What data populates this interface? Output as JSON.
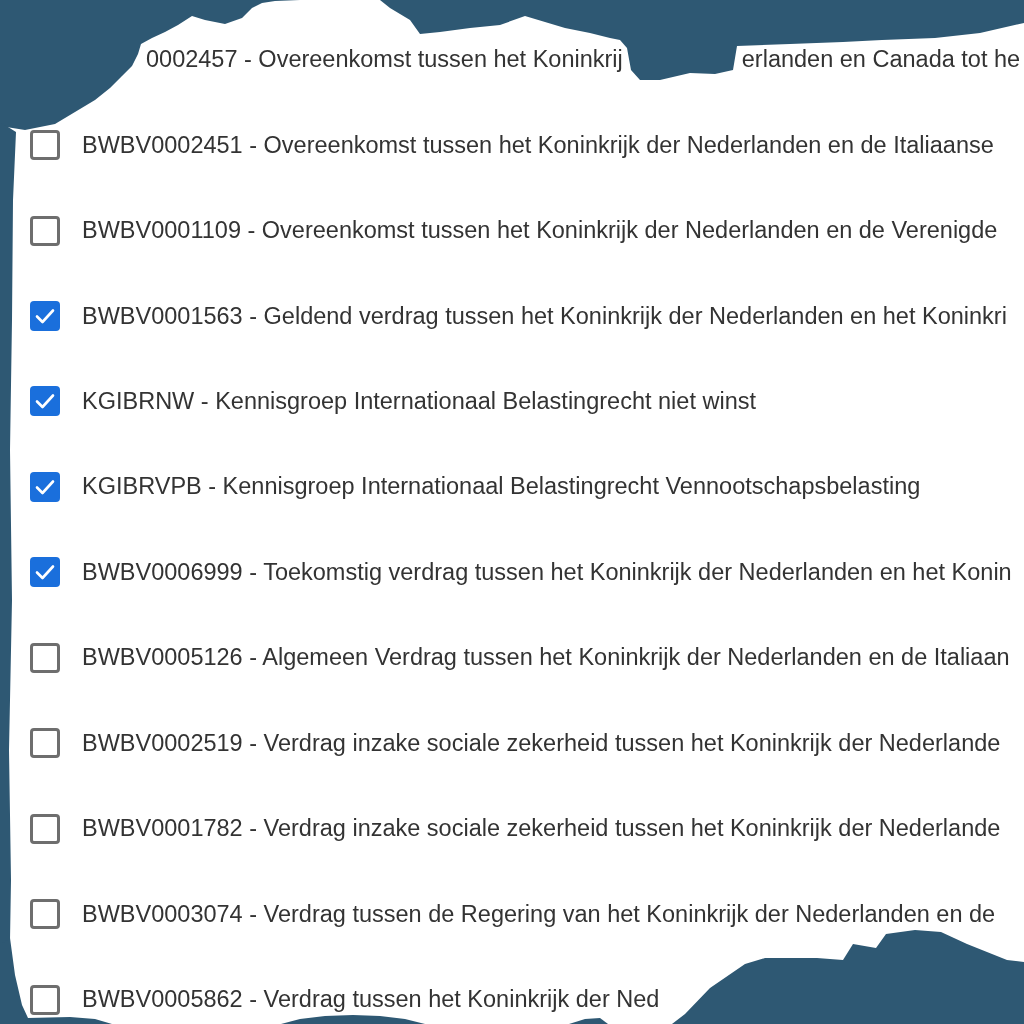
{
  "list": {
    "partial_row": {
      "fragments": [
        "0002457 - Overeenkomst tussen het Koninkrij",
        "erlanden en Canada tot he"
      ]
    },
    "rows": [
      {
        "label": "BWBV0002451 - Overeenkomst tussen het Koninkrijk der Nederlanden en de Italiaanse",
        "checked": false
      },
      {
        "label": "BWBV0001109 - Overeenkomst tussen het Koninkrijk der Nederlanden en de Verenigde",
        "checked": false
      },
      {
        "label": "BWBV0001563 - Geldend verdrag tussen het Koninkrijk der Nederlanden en het Koninkri",
        "checked": true
      },
      {
        "label": "KGIBRNW - Kennisgroep Internationaal Belastingrecht niet winst",
        "checked": true
      },
      {
        "label": "KGIBRVPB - Kennisgroep Internationaal Belastingrecht Vennootschapsbelasting",
        "checked": true
      },
      {
        "label": "BWBV0006999 - Toekomstig verdrag tussen het Koninkrijk der Nederlanden en het Konin",
        "checked": true
      },
      {
        "label": "BWBV0005126 - Algemeen Verdrag tussen het Koninkrijk der Nederlanden en de Italiaan",
        "checked": false
      },
      {
        "label": "BWBV0002519 - Verdrag inzake sociale zekerheid tussen het Koninkrijk der Nederlande",
        "checked": false
      },
      {
        "label": "BWBV0001782 - Verdrag inzake sociale zekerheid tussen het Koninkrijk der Nederlande",
        "checked": false
      },
      {
        "label": "BWBV0003074 - Verdrag tussen de Regering van het Koninkrijk der Nederlanden en de",
        "checked": false
      },
      {
        "label": "BWBV0005862 - Verdrag tussen het Koninkrijk der Ned",
        "checked": false
      }
    ]
  }
}
